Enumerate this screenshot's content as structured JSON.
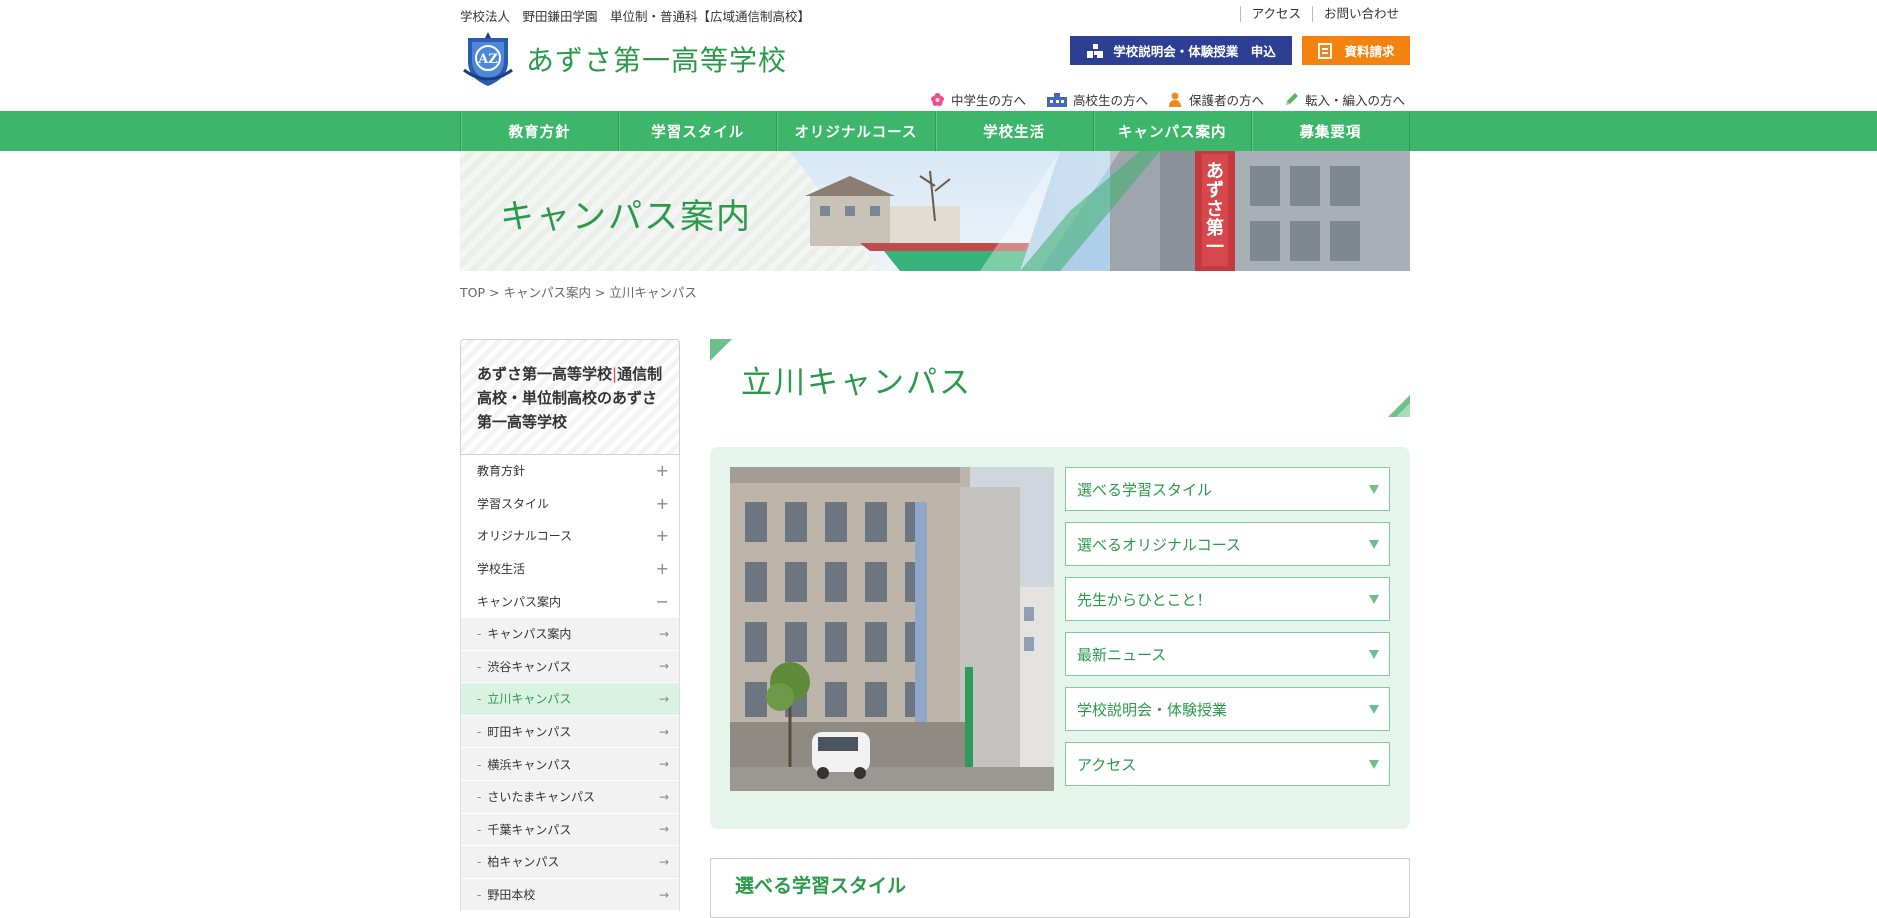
{
  "header": {
    "tagline": "学校法人　野田鎌田学園　単位制・普通科【広域通信制高校】",
    "top_links": [
      "アクセス",
      "お問い合わせ"
    ],
    "logo_text": "あずさ第一高等学校",
    "btn_event": "学校説明会・体験授業　申込",
    "btn_request": "資料請求",
    "audience_links": [
      {
        "label": "中学生の方へ",
        "icon": "flower-icon"
      },
      {
        "label": "高校生の方へ",
        "icon": "school-building-icon"
      },
      {
        "label": "保護者の方へ",
        "icon": "parent-icon"
      },
      {
        "label": "転入・編入の方へ",
        "icon": "pencil-icon"
      }
    ]
  },
  "nav": [
    "教育方針",
    "学習スタイル",
    "オリジナルコース",
    "学校生活",
    "キャンパス案内",
    "募集要項"
  ],
  "hero": {
    "title": "キャンパス案内",
    "sign_text": "あずさ第一高等"
  },
  "breadcrumb": [
    "TOP",
    "キャンパス案内",
    "立川キャンパス"
  ],
  "breadcrumb_sep": " > ",
  "sidebar": {
    "head_a": "あずさ第一高等学校",
    "head_sep": "|",
    "head_b": "通信制高校・単位制高校のあずさ第一高等学校",
    "items": [
      {
        "label": "教育方針",
        "sign": "+"
      },
      {
        "label": "学習スタイル",
        "sign": "+"
      },
      {
        "label": "オリジナルコース",
        "sign": "+"
      },
      {
        "label": "学校生活",
        "sign": "+"
      },
      {
        "label": "キャンパス案内",
        "sign": "−"
      }
    ],
    "sub_items": [
      "キャンパス案内",
      "渋谷キャンパス",
      "立川キャンパス",
      "町田キャンパス",
      "横浜キャンパス",
      "さいたまキャンパス",
      "千葉キャンパス",
      "柏キャンパス",
      "野田本校"
    ],
    "active_sub": "立川キャンパス"
  },
  "main": {
    "title": "立川キャンパス",
    "anchors": [
      "選べる学習スタイル",
      "選べるオリジナルコース",
      "先生からひとこと！",
      "最新ニュース",
      "学校説明会・体験授業",
      "アクセス"
    ],
    "section_title": "選べる学習スタイル"
  },
  "colors": {
    "green": "#3db66b",
    "green_text": "#2a9a4a",
    "navy": "#2d3f92",
    "orange": "#f5820f",
    "panel": "#e5f5eb"
  }
}
